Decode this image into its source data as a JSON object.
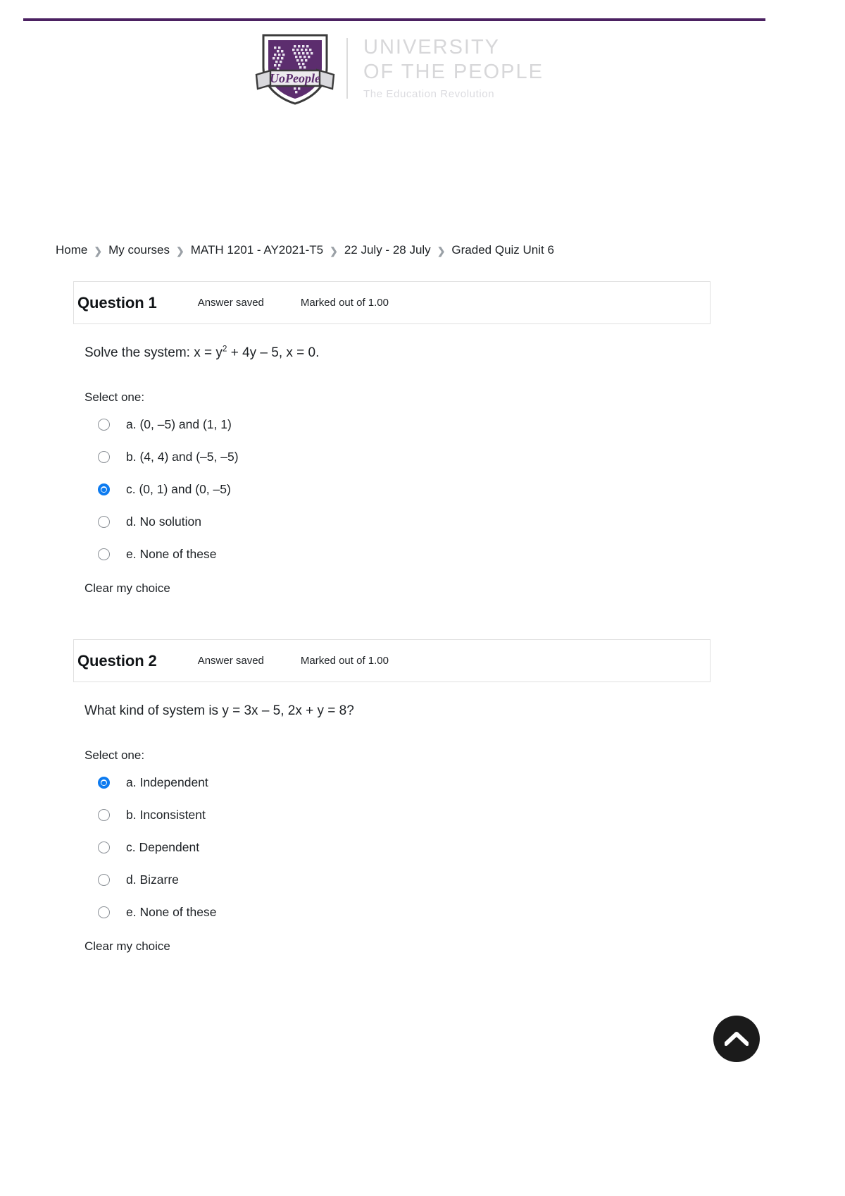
{
  "theme": {
    "accent_purple": "#4b2161",
    "radio_selected_blue": "#0d7bf0",
    "logo_text_gray": "#d7d7d9",
    "border_gray": "#e0e0e0"
  },
  "brand": {
    "shield_label": "UoPeople",
    "line1": "UNIVERSITY",
    "line2": "OF THE PEOPLE",
    "tagline": "The Education Revolution"
  },
  "breadcrumb": {
    "separator": "❯",
    "items": [
      {
        "label": "Home"
      },
      {
        "label": "My courses"
      },
      {
        "label": "MATH 1201 - AY2021-T5"
      },
      {
        "label": "22 July - 28 July"
      },
      {
        "label": "Graded Quiz Unit 6"
      }
    ]
  },
  "questions": [
    {
      "title": "Question 1",
      "state": "Answer saved",
      "mark": "Marked out of 1.00",
      "text_before": "Solve the system: x = y",
      "text_sup": "2",
      "text_after": " + 4y – 5, x = 0.",
      "select_prompt": "Select one:",
      "clear_label": "Clear my choice",
      "options": [
        {
          "label": "a. (0, –5) and (1, 1)",
          "selected": false
        },
        {
          "label": "b. (4, 4) and (–5, –5)",
          "selected": false
        },
        {
          "label": "c. (0, 1) and (0, –5)",
          "selected": true
        },
        {
          "label": "d. No solution",
          "selected": false
        },
        {
          "label": "e. None of these",
          "selected": false
        }
      ]
    },
    {
      "title": "Question 2",
      "state": "Answer saved",
      "mark": "Marked out of 1.00",
      "text_before": "What kind of system is y = 3x – 5, 2x + y = 8?",
      "text_sup": "",
      "text_after": "",
      "select_prompt": "Select one:",
      "clear_label": "Clear my choice",
      "options": [
        {
          "label": "a. Independent",
          "selected": true
        },
        {
          "label": "b. Inconsistent",
          "selected": false
        },
        {
          "label": "c. Dependent",
          "selected": false
        },
        {
          "label": "d. Bizarre",
          "selected": false
        },
        {
          "label": "e. None of these",
          "selected": false
        }
      ]
    }
  ],
  "back_to_top": {
    "icon": "chevron-up-icon"
  }
}
